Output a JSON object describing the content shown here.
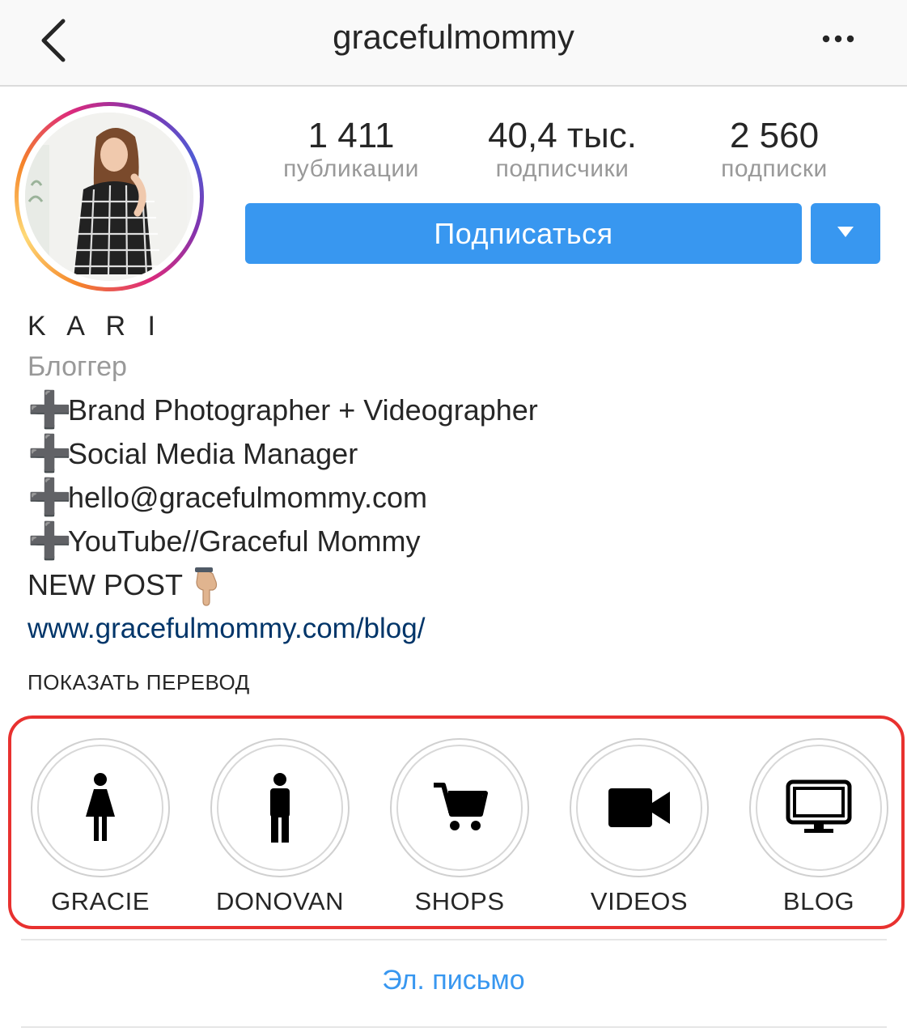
{
  "header": {
    "username": "gracefulmommy",
    "back_icon": "chevron-left-icon",
    "more_icon": "ellipsis-icon"
  },
  "stats": {
    "posts": {
      "value": "1 411",
      "label": "публикации"
    },
    "followers": {
      "value": "40,4 тыс.",
      "label": "подписчики"
    },
    "following": {
      "value": "2 560",
      "label": "подписки"
    }
  },
  "actions": {
    "follow_label": "Подписаться",
    "dropdown_icon": "caret-down-icon",
    "accent_color": "#3897f0"
  },
  "bio": {
    "name": "K A R I",
    "category": "Блоггер",
    "lines": [
      "Brand Photographer + Videographer",
      "Social Media Manager",
      "hello@gracefulmommy.com",
      "YouTube//Graceful Mommy"
    ],
    "plus_glyph": "➕",
    "new_post": "NEW POST",
    "link": "www.gracefulmommy.com/blog/",
    "link_color": "#003569"
  },
  "show_translation": "ПОКАЗАТЬ ПЕРЕВОД",
  "highlights": [
    {
      "label": "GRACIE",
      "icon": "woman-icon"
    },
    {
      "label": "DONOVAN",
      "icon": "man-icon"
    },
    {
      "label": "SHOPS",
      "icon": "shopping-cart-icon"
    },
    {
      "label": "VIDEOS",
      "icon": "video-camera-icon"
    },
    {
      "label": "BLOG",
      "icon": "monitor-icon"
    }
  ],
  "highlight_frame_color": "#e8312f",
  "contact": {
    "email_label": "Эл. письмо"
  }
}
